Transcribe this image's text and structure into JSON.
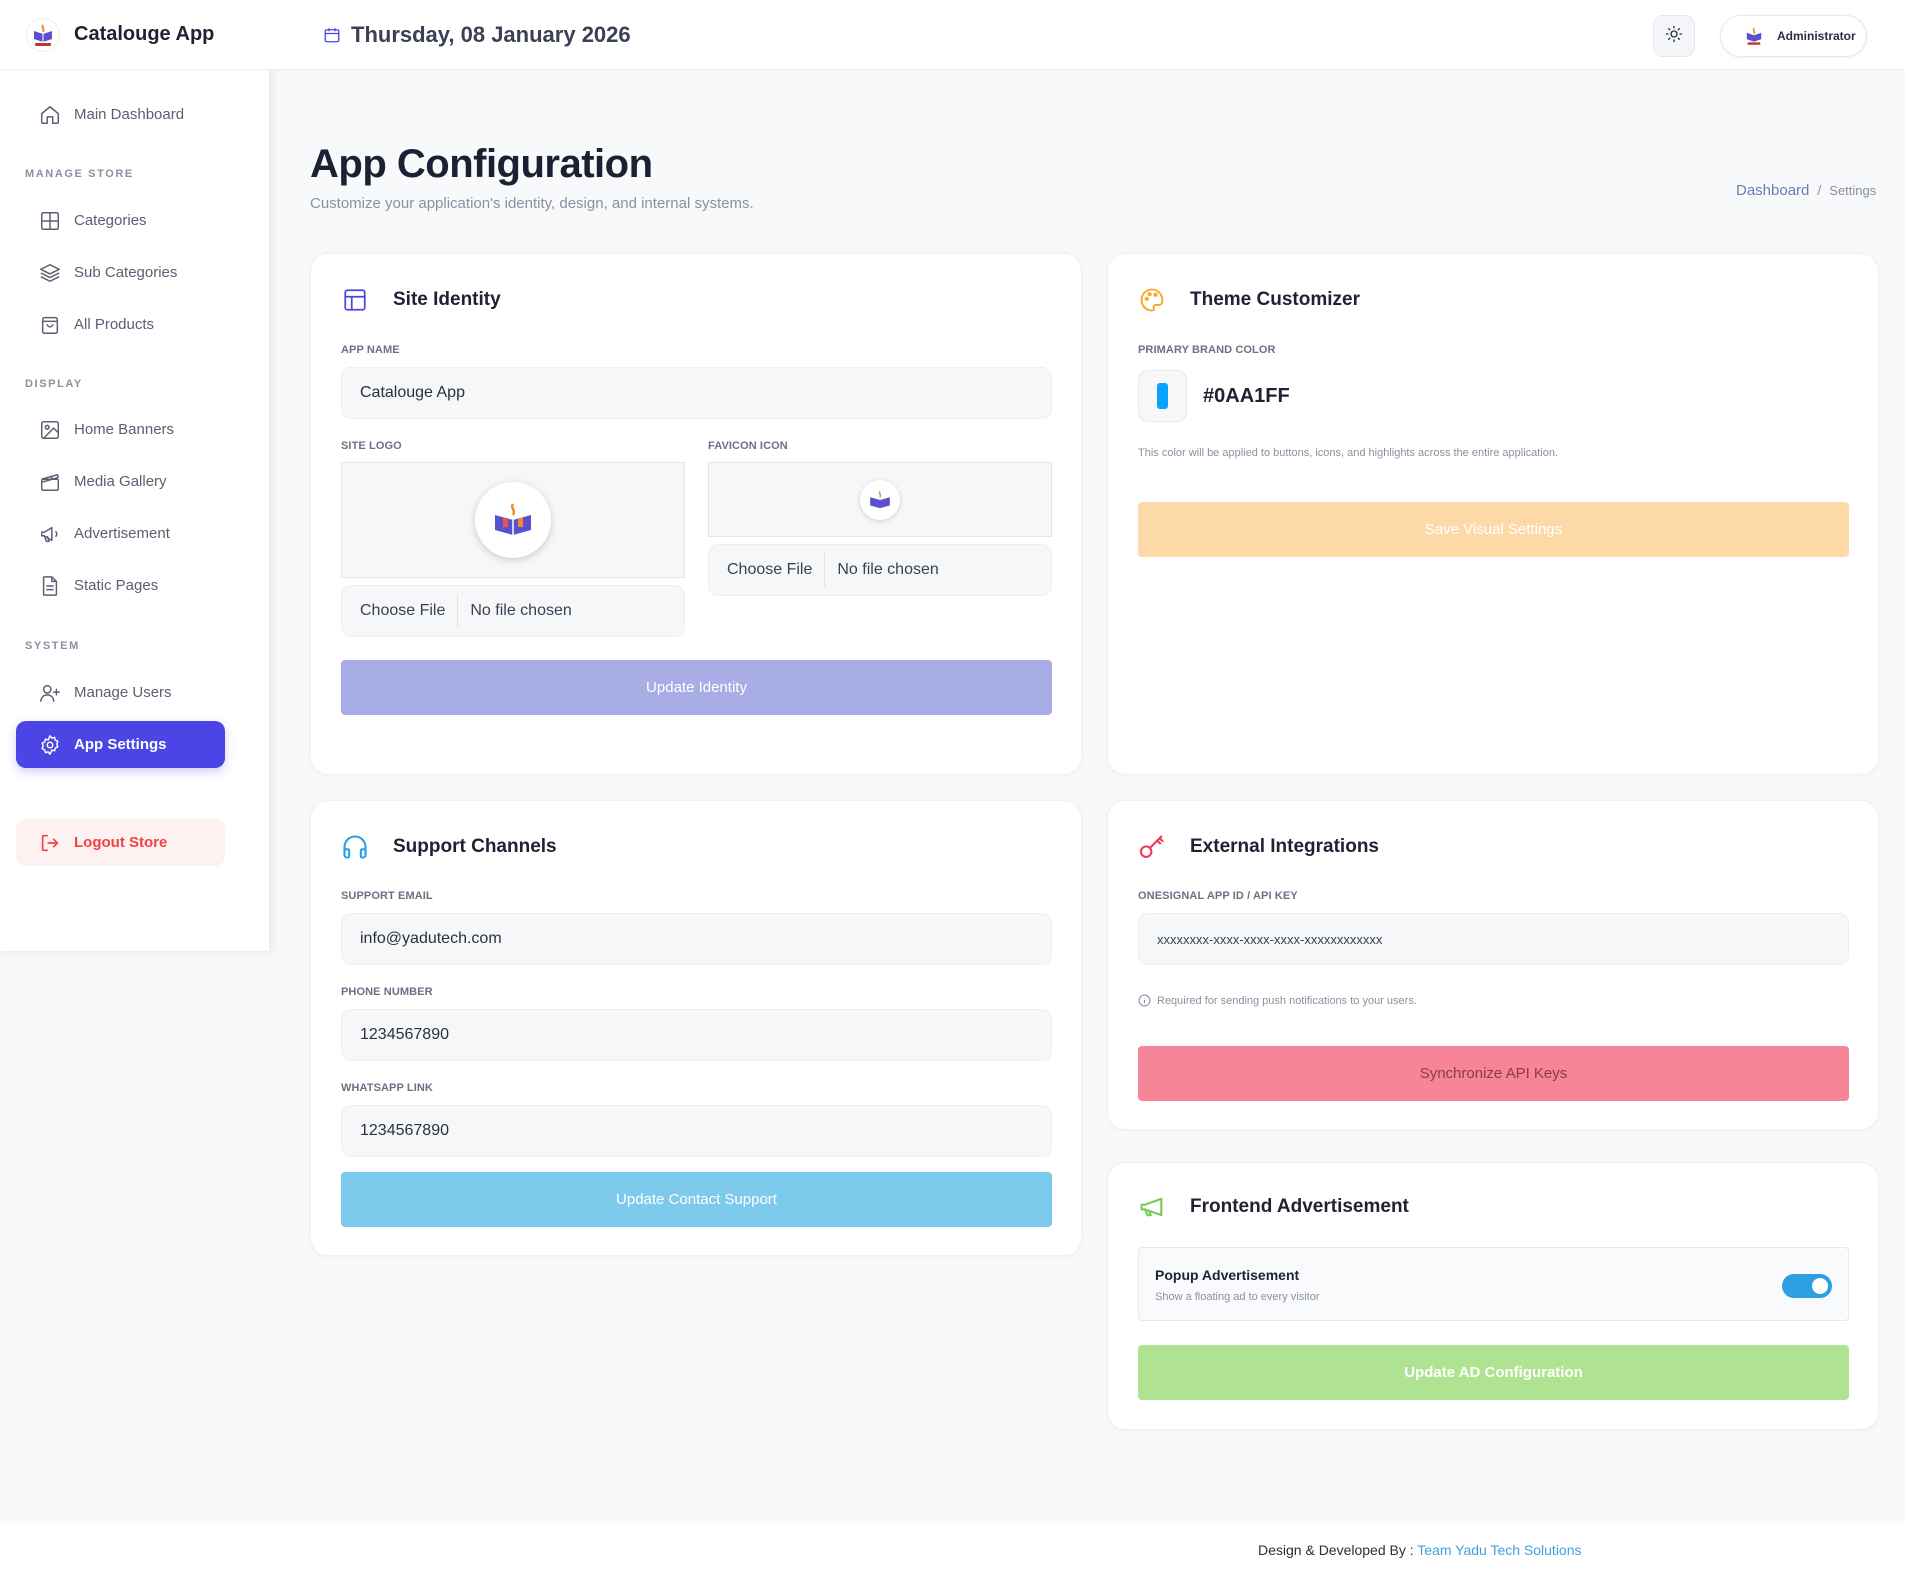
{
  "brand": {
    "name": "Catalouge App",
    "logo_text": "Catalouge App"
  },
  "sidebar": {
    "main": {
      "label": "Main Dashboard",
      "icon": "home-icon"
    },
    "sections": {
      "manage_store": "MANAGE STORE",
      "display": "DISPLAY",
      "system": "SYSTEM"
    },
    "items": [
      {
        "label": "Categories",
        "icon": "grid-icon"
      },
      {
        "label": "Sub Categories",
        "icon": "layers-icon"
      },
      {
        "label": "All Products",
        "icon": "bag-icon"
      },
      {
        "label": "Home Banners",
        "icon": "image-icon"
      },
      {
        "label": "Media Gallery",
        "icon": "clapperboard-icon"
      },
      {
        "label": "Advertisement",
        "icon": "megaphone-icon"
      },
      {
        "label": "Static Pages",
        "icon": "document-icon"
      },
      {
        "label": "Manage Users",
        "icon": "user-plus-icon"
      },
      {
        "label": "App Settings",
        "icon": "gear-icon"
      }
    ],
    "logout": "Logout Store"
  },
  "header": {
    "date": "Thursday, 08 January 2026",
    "user": "Administrator"
  },
  "page": {
    "title": "App Configuration",
    "subtitle": "Customize your application's identity, design, and internal systems.",
    "breadcrumb": {
      "link": "Dashboard",
      "separator": "/",
      "current": "Settings"
    }
  },
  "site_identity": {
    "title": "Site Identity",
    "app_name_label": "APP NAME",
    "app_name_value": "Catalouge App",
    "site_logo_label": "SITE LOGO",
    "favicon_label": "FAVICON ICON",
    "choose_file": "Choose File",
    "no_file": "No file chosen",
    "button": "Update Identity"
  },
  "theme": {
    "title": "Theme Customizer",
    "label": "PRIMARY BRAND COLOR",
    "hex": "#0AA1FF",
    "note": "This color will be applied to buttons, icons, and highlights across the entire application.",
    "button": "Save Visual Settings"
  },
  "support": {
    "title": "Support Channels",
    "email_label": "SUPPORT EMAIL",
    "email_value": "info@yadutech.com",
    "phone_label": "PHONE NUMBER",
    "phone_value": "1234567890",
    "whatsapp_label": "WHATSAPP LINK",
    "whatsapp_value": "1234567890",
    "button": "Update Contact Support"
  },
  "integrations": {
    "title": "External Integrations",
    "label": "ONESIGNAL APP ID / API KEY",
    "placeholder": "xxxxxxxx-xxxx-xxxx-xxxx-xxxxxxxxxxxx",
    "note": "Required for sending push notifications to your users.",
    "button": "Synchronize API Keys"
  },
  "advertisement": {
    "title": "Frontend Advertisement",
    "toggle_title": "Popup Advertisement",
    "toggle_sub": "Show a floating ad to every visitor",
    "toggle_on": true,
    "button": "Update AD Configuration"
  },
  "footer": {
    "prefix": "Design & Developed By :",
    "link": "Team Yadu Tech Solutions"
  },
  "colors": {
    "accent": "#4a45e4",
    "brand_primary": "#0AA1FF",
    "identity_btn": "#a9ade6",
    "theme_btn": "#fdd9a8",
    "support_btn": "#7dcaec",
    "integrations_btn": "#f78598",
    "ad_btn": "#b0e391",
    "toggle": "#2e9fe0"
  }
}
